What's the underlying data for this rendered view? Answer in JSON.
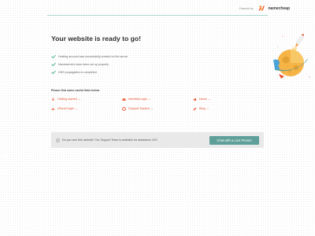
{
  "header": {
    "powered_by": "Powered by",
    "brand_name": "namecheap"
  },
  "main": {
    "title": "Your website is ready to go!",
    "checks": [
      {
        "icon": "check-icon",
        "text": "Hosting account was successfully created on the server"
      },
      {
        "icon": "check-icon",
        "text": "Nameservers have been set up properly"
      },
      {
        "icon": "check-icon",
        "text": "DNS propagation is completed"
      }
    ],
    "links_heading": "Please find some useful links below",
    "links": [
      {
        "icon": "rocket-icon",
        "label": "Getting started →"
      },
      {
        "icon": "envelope-icon",
        "label": "WebMail login →"
      },
      {
        "icon": "megaphone-icon",
        "label": "News →"
      },
      {
        "icon": "gauge-icon",
        "label": "cPanel login →"
      },
      {
        "icon": "lifebuoy-icon",
        "label": "Support System →"
      },
      {
        "icon": "pencil-icon",
        "label": "Blog →"
      }
    ]
  },
  "support": {
    "info_icon": "info-icon",
    "text": "Do you own this website? Our Support Team is available for assistance 24/7.",
    "button_label": "Chat with a Live Person"
  },
  "colors": {
    "accent_orange": "#e8532e",
    "check_green": "#5ab48a",
    "button_teal": "#5f9f99",
    "support_bg": "#e9e9e9"
  }
}
